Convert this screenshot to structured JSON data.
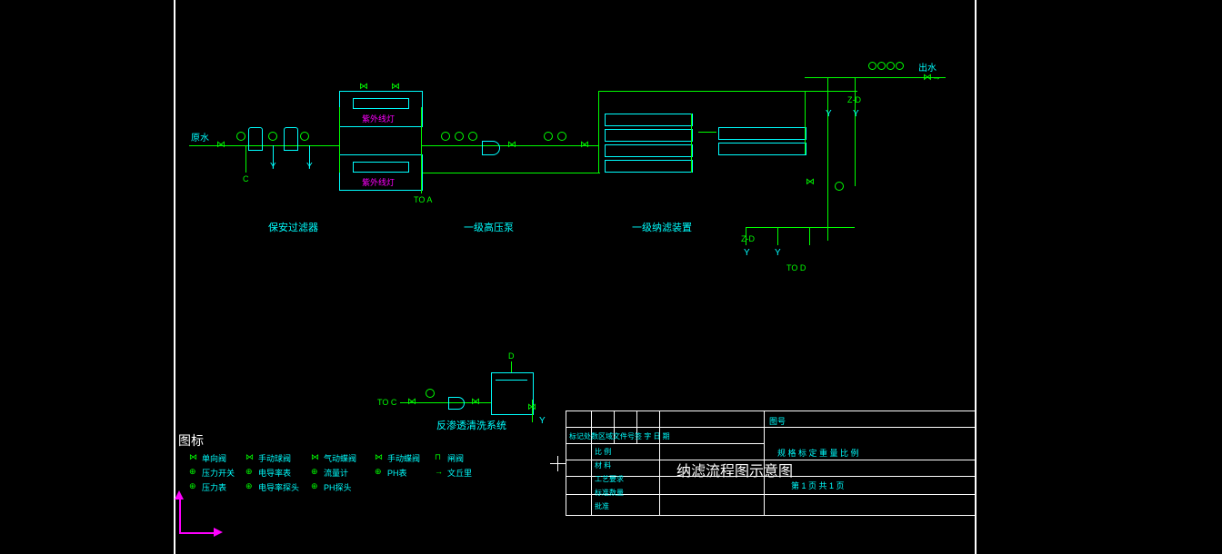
{
  "labels": {
    "inlet": "原水",
    "outlet": "出水",
    "c": "C",
    "d": "D",
    "to_a": "TO A",
    "to_c": "TO C",
    "to_d": "TO D",
    "zd1": "Z-D",
    "zd2": "Z-D",
    "uv1": "紫外线灯",
    "uv2": "紫外线灯",
    "stage_filter": "保安过滤器",
    "stage_pump": "一级高压泵",
    "stage_nf": "一级纳滤装置",
    "wash": "反渗透清洗系统"
  },
  "legend": {
    "title": "图标",
    "items": [
      {
        "sym": "⋈",
        "name": "单向阀"
      },
      {
        "sym": "⋈",
        "name": "手动球阀"
      },
      {
        "sym": "⋈",
        "name": "气动蝶阀"
      },
      {
        "sym": "⋈",
        "name": "手动蝶阀"
      },
      {
        "sym": "⊓",
        "name": "闸阀"
      },
      {
        "sym": "⊕",
        "name": "压力开关"
      },
      {
        "sym": "⊕",
        "name": "电导率表"
      },
      {
        "sym": "⊕",
        "name": "流量计"
      },
      {
        "sym": "⊕",
        "name": "PH表"
      },
      {
        "sym": "→",
        "name": "文丘里"
      },
      {
        "sym": "⊕",
        "name": "压力表"
      },
      {
        "sym": "⊕",
        "name": "电导率探头"
      },
      {
        "sym": "⊕",
        "name": "PH探头"
      }
    ]
  },
  "title_block": {
    "main_title": "纳滤流程图示意图",
    "rows": [
      "比 例",
      "材 料",
      "工艺要求",
      "标准数量",
      "批准"
    ],
    "cols": [
      "标记处数区域文件号签 字 日 期",
      "图号",
      "规 格 标 定 重 量 比 例",
      "第 1 页 共 1 页"
    ]
  }
}
